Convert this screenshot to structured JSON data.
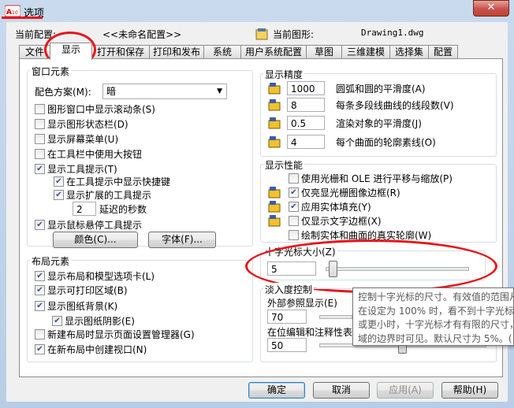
{
  "window": {
    "title": "选项",
    "close_glyph": "✕"
  },
  "profile": {
    "current_label": "当前配置:",
    "current_value": "<<未命名配置>>",
    "drawing_label": "当前图形:",
    "drawing_value": "Drawing1.dwg"
  },
  "tabs": [
    "文件",
    "显示",
    "打开和保存",
    "打印和发布",
    "系统",
    "用户系统配置",
    "草图",
    "三维建模",
    "选择集",
    "配置"
  ],
  "active_tab": "显示",
  "window_elements": {
    "title": "窗口元素",
    "color_scheme_label": "配色方案(M):",
    "color_scheme_value": "暗",
    "checks": [
      {
        "label": "图形窗口中显示滚动条(S)",
        "checked": false
      },
      {
        "label": "显示图形状态栏(D)",
        "checked": false
      },
      {
        "label": "显示屏幕菜单(U)",
        "checked": false
      },
      {
        "label": "在工具栏中使用大按钮",
        "checked": false
      },
      {
        "label": "显示工具提示(T)",
        "checked": true
      },
      {
        "label": "在工具提示中显示快捷键",
        "checked": true
      },
      {
        "label": "显示扩展的工具提示",
        "checked": true
      }
    ],
    "delay_value": "2",
    "delay_label": "延迟的秒数",
    "rollover_label": "显示鼠标悬停工具提示",
    "rollover_checked": true,
    "colors_button": "颜色(C)...",
    "fonts_button": "字体(F)..."
  },
  "layout_elements": {
    "title": "布局元素",
    "checks": [
      {
        "label": "显示布局和模型选项卡(L)",
        "checked": true
      },
      {
        "label": "显示可打印区域(B)",
        "checked": true
      },
      {
        "label": "显示图纸背景(K)",
        "checked": true
      },
      {
        "label": "显示图纸阴影(E)",
        "checked": true
      },
      {
        "label": "新建布局时显示页面设置管理器(G)",
        "checked": false
      },
      {
        "label": "在新布局中创建视口(N)",
        "checked": true
      }
    ]
  },
  "display_resolution": {
    "title": "显示精度",
    "rows": [
      {
        "value": "1000",
        "label": "圆弧和圆的平滑度(A)"
      },
      {
        "value": "8",
        "label": "每条多段线曲线的线段数(V)"
      },
      {
        "value": "0.5",
        "label": "渲染对象的平滑度(J)"
      },
      {
        "value": "4",
        "label": "每个曲面的轮廓素线(O)"
      }
    ]
  },
  "display_performance": {
    "title": "显示性能",
    "checks": [
      {
        "label": "使用光栅和 OLE 进行平移与缩放(P)",
        "checked": false
      },
      {
        "label": "仅亮显光栅图像边框(R)",
        "checked": true
      },
      {
        "label": "应用实体填充(Y)",
        "checked": true
      },
      {
        "label": "仅显示文字边框(X)",
        "checked": false
      },
      {
        "label": "绘制实体和曲面的真实轮廓(W)",
        "checked": false
      }
    ]
  },
  "crosshair": {
    "title": "十字光标大小(Z)",
    "value": "5",
    "slider_fraction": 0.05
  },
  "fade_control": {
    "title": "淡入度控制",
    "xref_label": "外部参照显示(E)",
    "xref_value": "70",
    "inplace_label": "在位编辑和注释性表",
    "inplace_value": "50"
  },
  "tooltip": {
    "lines": [
      "控制十字光标的尺寸。有效值的范围从",
      "在设定为 100% 时，看不到十字光标的",
      "或更小时，十字光标才有有限的尺寸，",
      "域的边界时可见。默认尺寸为 5%。("
    ]
  },
  "footer": {
    "ok": "确定",
    "cancel": "取消",
    "apply": "应用(A)",
    "help": "帮助(H)"
  },
  "colors": {
    "annotation_red": "#e8151b",
    "dialog_bg": "#f0f0f0",
    "focus_blue": "#3c7fb1"
  }
}
